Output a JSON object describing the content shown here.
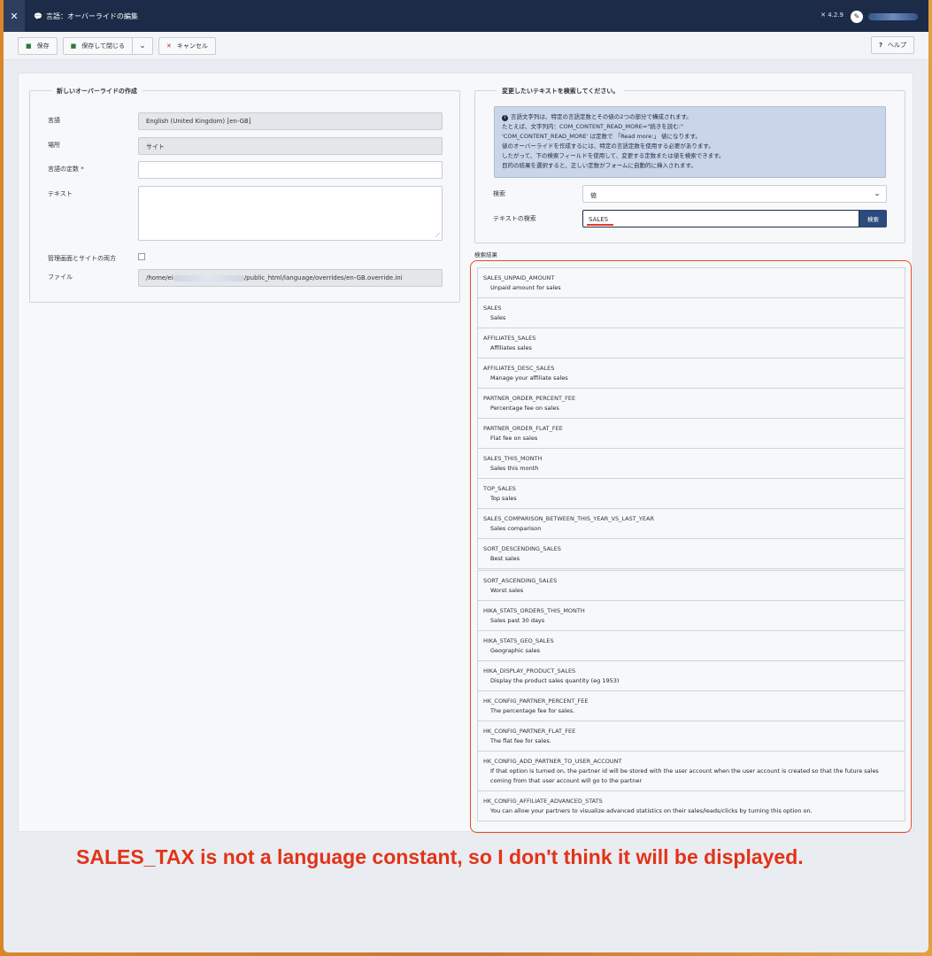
{
  "header": {
    "logo": "joomla-logo",
    "title": "言語：オーバーライドの編集",
    "version": "4.2.9"
  },
  "toolbar": {
    "save": "保存",
    "save_close": "保存して閉じる",
    "cancel": "キャンセル",
    "help": "ヘルプ"
  },
  "left_panel": {
    "legend": "新しいオーバーライドの作成",
    "language_label": "言語",
    "language_value": "English (United Kingdom) [en-GB]",
    "location_label": "場所",
    "location_value": "サイト",
    "constant_label": "言語の定数 *",
    "constant_value": "",
    "text_label": "テキスト",
    "text_value": "",
    "both_label": "管理画面とサイトの両方",
    "file_label": "ファイル",
    "file_value_start": "/home/ei",
    "file_value_end": "/public_html/language/overrides/en-GB.override.ini"
  },
  "right_panel": {
    "legend": "変更したいテキストを検索してください。",
    "info_lines": [
      "言語文字列は、特定の言語定数とその値の2つの部分で構成されます。",
      "たとえば、文字列内：COM_CONTENT_READ_MORE=\"続きを読む:\"",
      "'COM_CONTENT_READ_MORE' は定数で 「Read more:」 値になります。",
      "値のオーバーライドを作成するには、特定の言語定数を使用する必要があります。",
      "したがって、下の検索フィールドを使用して、変更する定数または値を検索できます。",
      "目的の結果を選択すると、正しい定数がフォームに自動的に挿入されます。"
    ],
    "search_type_label": "検索",
    "search_type_value": "値",
    "search_text_label": "テキストの検索",
    "search_text_value": "SALES",
    "search_button": "検索"
  },
  "results": {
    "label": "検索結果",
    "group1": [
      {
        "constant": "SALES_UNPAID_AMOUNT",
        "text": "Unpaid amount for sales"
      },
      {
        "constant": "SALES",
        "text": "Sales"
      },
      {
        "constant": "AFFILIATES_SALES",
        "text": "Affiliates sales"
      },
      {
        "constant": "AFFILIATES_DESC_SALES",
        "text": "Manage your affiliate sales"
      },
      {
        "constant": "PARTNER_ORDER_PERCENT_FEE",
        "text": "Percentage fee on sales"
      },
      {
        "constant": "PARTNER_ORDER_FLAT_FEE",
        "text": "Flat fee on sales"
      },
      {
        "constant": "SALES_THIS_MONTH",
        "text": "Sales this month"
      },
      {
        "constant": "TOP_SALES",
        "text": "Top sales"
      },
      {
        "constant": "SALES_COMPARISON_BETWEEN_THIS_YEAR_VS_LAST_YEAR",
        "text": "Sales comparison"
      },
      {
        "constant": "SORT_DESCENDING_SALES",
        "text": "Best sales"
      }
    ],
    "group2": [
      {
        "constant": "SORT_ASCENDING_SALES",
        "text": "Worst sales"
      },
      {
        "constant": "HIKA_STATS_ORDERS_THIS_MONTH",
        "text": "Sales past 30 days"
      },
      {
        "constant": "HIKA_STATS_GEO_SALES",
        "text": "Geographic sales"
      },
      {
        "constant": "HIKA_DISPLAY_PRODUCT_SALES",
        "text": "Display the product sales quantity (eg 1953)"
      },
      {
        "constant": "HK_CONFIG_PARTNER_PERCENT_FEE",
        "text": "The percentage fee for sales."
      },
      {
        "constant": "HK_CONFIG_PARTNER_FLAT_FEE",
        "text": "The flat fee for sales."
      },
      {
        "constant": "HK_CONFIG_ADD_PARTNER_TO_USER_ACCOUNT",
        "text": "If that option is turned on, the partner id will be stored with the user account when the user account is created so that the future sales coming from that user account will go to the partner"
      },
      {
        "constant": "HK_CONFIG_AFFILIATE_ADVANCED_STATS",
        "text": "You can allow your partners to visualize advanced statistics on their sales/leads/clicks by turning this option on."
      }
    ]
  },
  "note": "SALES_TAX is not a language constant, so I don't think it will be displayed.",
  "colors": {
    "header_bg": "#1c2b47",
    "accent_blue": "#2c4a7c",
    "annotation_red": "#e23318"
  }
}
